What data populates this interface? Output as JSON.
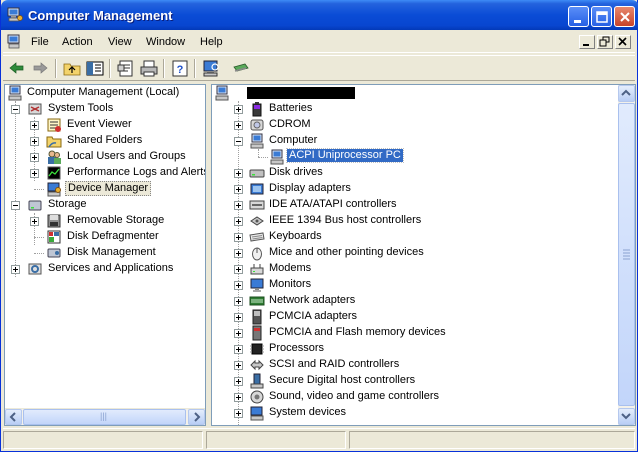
{
  "window": {
    "title": "Computer Management"
  },
  "menu": [
    "File",
    "Action",
    "View",
    "Window",
    "Help"
  ],
  "toolbar": {
    "icons": [
      "back-arrow-icon",
      "forward-arrow-icon",
      "up-folder-icon",
      "show-tree-icon",
      "properties-icon",
      "print-icon",
      "help-icon",
      "scan-hardware-icon",
      "remove-device-icon"
    ]
  },
  "left_tree": {
    "root": "Computer Management (Local)",
    "items": [
      {
        "label": "System Tools",
        "level": 1,
        "expander": "minus",
        "icon": "tools-icon"
      },
      {
        "label": "Event Viewer",
        "level": 2,
        "expander": "plus",
        "icon": "event-viewer-icon"
      },
      {
        "label": "Shared Folders",
        "level": 2,
        "expander": "plus",
        "icon": "shared-folder-icon"
      },
      {
        "label": "Local Users and Groups",
        "level": 2,
        "expander": "plus",
        "icon": "users-icon"
      },
      {
        "label": "Performance Logs and Alerts",
        "level": 2,
        "expander": "plus",
        "icon": "performance-icon"
      },
      {
        "label": "Device Manager",
        "level": 2,
        "expander": "none",
        "icon": "device-manager-icon",
        "selected": true
      },
      {
        "label": "Storage",
        "level": 1,
        "expander": "minus",
        "icon": "storage-icon"
      },
      {
        "label": "Removable Storage",
        "level": 2,
        "expander": "plus",
        "icon": "removable-storage-icon"
      },
      {
        "label": "Disk Defragmenter",
        "level": 2,
        "expander": "none",
        "icon": "defrag-icon"
      },
      {
        "label": "Disk Management",
        "level": 2,
        "expander": "none",
        "icon": "disk-management-icon"
      },
      {
        "label": "Services and Applications",
        "level": 1,
        "expander": "plus",
        "icon": "services-icon"
      }
    ]
  },
  "right_tree": {
    "root": "",
    "items": [
      {
        "label": "Batteries",
        "expander": "plus",
        "icon": "battery-icon"
      },
      {
        "label": "CDROM",
        "expander": "plus",
        "icon": "cdrom-icon"
      },
      {
        "label": "Computer",
        "expander": "minus",
        "icon": "computer-icon"
      },
      {
        "label": "ACPI Uniprocessor PC",
        "expander": "none",
        "icon": "computer-icon",
        "child": true,
        "highlighted": true
      },
      {
        "label": "Disk drives",
        "expander": "plus",
        "icon": "disk-drive-icon"
      },
      {
        "label": "Display adapters",
        "expander": "plus",
        "icon": "display-adapter-icon"
      },
      {
        "label": "IDE ATA/ATAPI controllers",
        "expander": "plus",
        "icon": "ide-controller-icon"
      },
      {
        "label": "IEEE 1394 Bus host controllers",
        "expander": "plus",
        "icon": "ieee1394-icon"
      },
      {
        "label": "Keyboards",
        "expander": "plus",
        "icon": "keyboard-icon"
      },
      {
        "label": "Mice and other pointing devices",
        "expander": "plus",
        "icon": "mouse-icon"
      },
      {
        "label": "Modems",
        "expander": "plus",
        "icon": "modem-icon"
      },
      {
        "label": "Monitors",
        "expander": "plus",
        "icon": "monitor-icon"
      },
      {
        "label": "Network adapters",
        "expander": "plus",
        "icon": "network-adapter-icon"
      },
      {
        "label": "PCMCIA adapters",
        "expander": "plus",
        "icon": "pcmcia-icon"
      },
      {
        "label": "PCMCIA and Flash memory devices",
        "expander": "plus",
        "icon": "flash-memory-icon"
      },
      {
        "label": "Processors",
        "expander": "plus",
        "icon": "processor-icon"
      },
      {
        "label": "SCSI and RAID controllers",
        "expander": "plus",
        "icon": "scsi-icon"
      },
      {
        "label": "Secure Digital host controllers",
        "expander": "plus",
        "icon": "sd-host-icon"
      },
      {
        "label": "Sound, video and game controllers",
        "expander": "plus",
        "icon": "sound-icon"
      },
      {
        "label": "System devices",
        "expander": "plus",
        "icon": "system-devices-icon"
      }
    ]
  },
  "left_scrollbar": {
    "thumb_grip": "|||"
  },
  "colors": {
    "title_bar": "#0A4CD6",
    "selection": "#316AC5",
    "face": "#ECE9D8"
  }
}
